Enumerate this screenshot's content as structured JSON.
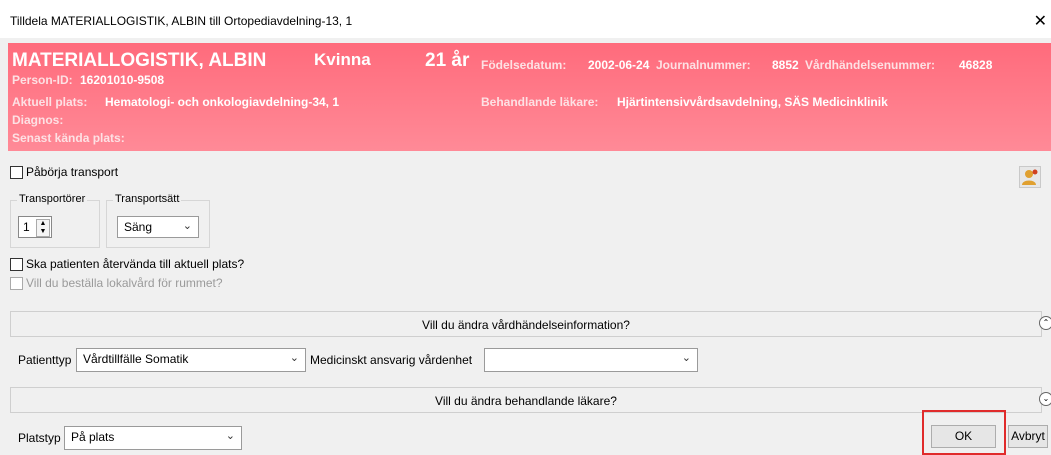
{
  "window": {
    "title": "Tilldela MATERIALLOGISTIK, ALBIN till Ortopediavdelning-13, 1",
    "close": "✕"
  },
  "patient": {
    "name": "MATERIALLOGISTIK, ALBIN",
    "gender": "Kvinna",
    "age": "21 år",
    "birth_label": "Födelsedatum:",
    "birth_value": "2002-06-24",
    "journal_label": "Journalnummer:",
    "journal_value": "8852",
    "event_label": "Vårdhändelsenummer:",
    "event_value": "46828",
    "pid_label": "Person-ID:",
    "pid_value": "16201010-9508",
    "place_label": "Aktuell plats:",
    "place_value": "Hematologi- och onkologiavdelning-34, 1",
    "doctor_label": "Behandlande läkare:",
    "doctor_value": "Hjärtintensivvårdsavdelning, SÄS Medicinklinik",
    "diagnosis_label": "Diagnos:",
    "last_place_label": "Senast kända plats:"
  },
  "transport": {
    "start_label": "Påbörja transport",
    "carriers_legend": "Transportörer",
    "carriers_value": "1",
    "mode_legend": "Transportsätt",
    "mode_value": "Säng",
    "return_label": "Ska patienten återvända till aktuell plats?",
    "local_care_label": "Vill du beställa lokalvård för rummet?"
  },
  "care_event_bar": "Vill du ändra vårdhändelseinformation?",
  "patient_type_label": "Patienttyp",
  "patient_type_value": "Vårdtillfälle Somatik",
  "responsible_unit_label": "Medicinskt ansvarig vårdenhet",
  "responsible_unit_value": "",
  "doctor_bar": "Vill du ändra behandlande läkare?",
  "place_type_label": "Platstyp",
  "place_type_value": "På plats",
  "ok_label": "OK",
  "cancel_label": "Avbryt",
  "colors": {
    "header": "#ff7384",
    "highlight": "#e02b2b"
  }
}
